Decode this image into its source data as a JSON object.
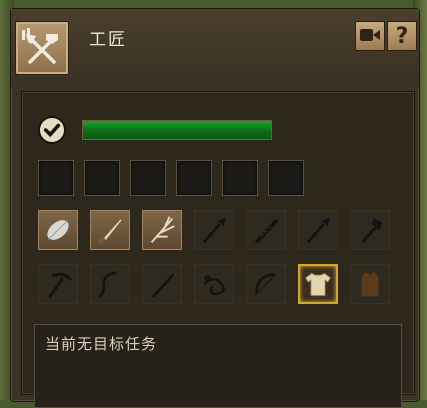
{
  "header": {
    "title": "工匠",
    "profession_icon": "crossed-tools-icon",
    "camera_icon": "video-camera-icon",
    "help_label": "?"
  },
  "progress": {
    "completed_icon": "checkmark-icon",
    "fraction": 1.0,
    "color": "#1a8f27"
  },
  "empty_slots": 6,
  "recipes": [
    {
      "icon": "leaf-icon",
      "state": "unlocked"
    },
    {
      "icon": "knife-icon",
      "state": "unlocked"
    },
    {
      "icon": "branch-icon",
      "state": "unlocked"
    },
    {
      "icon": "spear-icon",
      "state": "locked"
    },
    {
      "icon": "saw-blade-icon",
      "state": "locked"
    },
    {
      "icon": "spear-icon",
      "state": "locked"
    },
    {
      "icon": "axe-icon",
      "state": "locked"
    },
    {
      "icon": "pickaxe-icon",
      "state": "locked"
    },
    {
      "icon": "sickle-icon",
      "state": "locked"
    },
    {
      "icon": "blade-icon",
      "state": "locked"
    },
    {
      "icon": "rope-icon",
      "state": "locked"
    },
    {
      "icon": "bow-icon",
      "state": "locked"
    },
    {
      "icon": "shirt-icon",
      "state": "selected"
    },
    {
      "icon": "vest-icon",
      "state": "locked"
    }
  ],
  "task": {
    "text": "当前无目标任务"
  }
}
